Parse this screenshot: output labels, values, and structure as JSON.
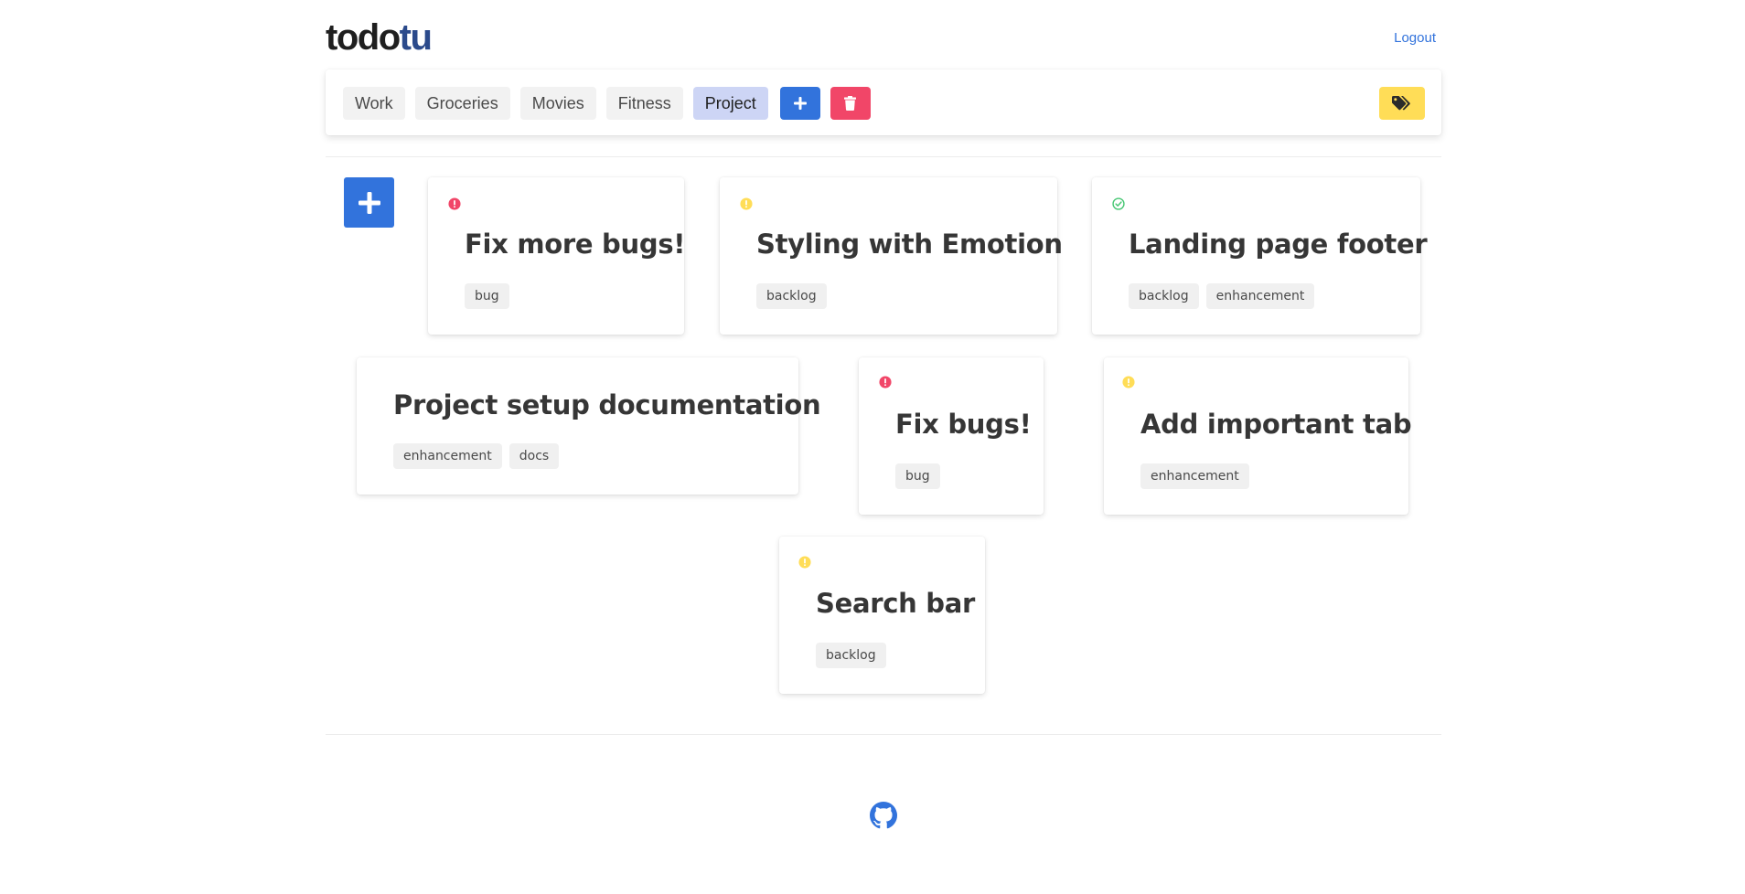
{
  "app": {
    "logo_part1": "todo",
    "logo_part2": "tu",
    "logout_label": "Logout"
  },
  "toolbar": {
    "tabs": [
      {
        "label": "Work"
      },
      {
        "label": "Groceries"
      },
      {
        "label": "Movies"
      },
      {
        "label": "Fitness"
      },
      {
        "label": "Project",
        "active": true
      }
    ],
    "add_icon": "plus-icon",
    "delete_icon": "trash-icon",
    "tags_icon": "tags-icon"
  },
  "add_todo_icon": "plus-icon",
  "cards": [
    {
      "title": "Fix more bugs!",
      "status": "high-priority",
      "tags": [
        "bug"
      ]
    },
    {
      "title": "Styling with Emotion",
      "status": "medium-priority",
      "tags": [
        "backlog"
      ]
    },
    {
      "title": "Landing page footer",
      "status": "done",
      "tags": [
        "backlog",
        "enhancement"
      ]
    },
    {
      "title": "Project setup documentation",
      "status": "none",
      "tags": [
        "enhancement",
        "docs"
      ]
    },
    {
      "title": "Fix bugs!",
      "status": "high-priority",
      "tags": [
        "bug"
      ]
    },
    {
      "title": "Add important tab",
      "status": "medium-priority",
      "tags": [
        "enhancement"
      ]
    },
    {
      "title": "Search bar",
      "status": "medium-priority",
      "tags": [
        "backlog"
      ]
    }
  ],
  "colors": {
    "primary": "#3273dc",
    "danger": "#f14668",
    "warning": "#ffdd57",
    "success": "#48c774",
    "active_tab": "#cdd5f5"
  },
  "footer": {
    "icon": "github-icon"
  }
}
